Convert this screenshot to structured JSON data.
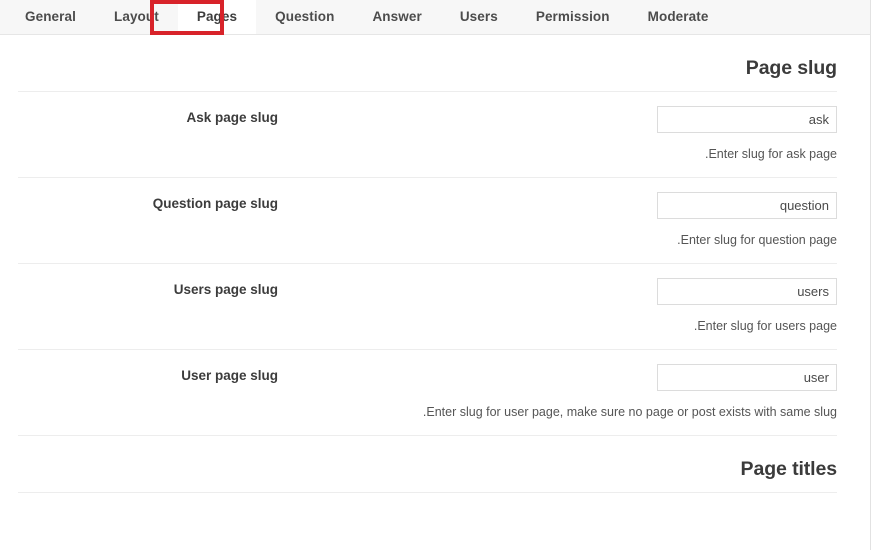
{
  "tabs": [
    {
      "label": "General",
      "active": false
    },
    {
      "label": "Layout",
      "active": false
    },
    {
      "label": "Pages",
      "active": true
    },
    {
      "label": "Question",
      "active": false
    },
    {
      "label": "Answer",
      "active": false
    },
    {
      "label": "Users",
      "active": false
    },
    {
      "label": "Permission",
      "active": false
    },
    {
      "label": "Moderate",
      "active": false
    }
  ],
  "annotation": {
    "target_tab": "Pages",
    "color": "#d8232a"
  },
  "sections": [
    {
      "heading": "Page slug",
      "fields": [
        {
          "label": "Ask page slug",
          "value": "ask",
          "placeholder": "ask",
          "description": ".Enter slug for ask page"
        },
        {
          "label": "Question page slug",
          "value": "question",
          "placeholder": "question",
          "description": ".Enter slug for question page"
        },
        {
          "label": "Users page slug",
          "value": "users",
          "placeholder": "users",
          "description": ".Enter slug for users page"
        },
        {
          "label": "User page slug",
          "value": "user",
          "placeholder": "user",
          "description": ".Enter slug for user page, make sure no page or post exists with same slug"
        }
      ]
    },
    {
      "heading": "Page titles",
      "fields": []
    }
  ]
}
